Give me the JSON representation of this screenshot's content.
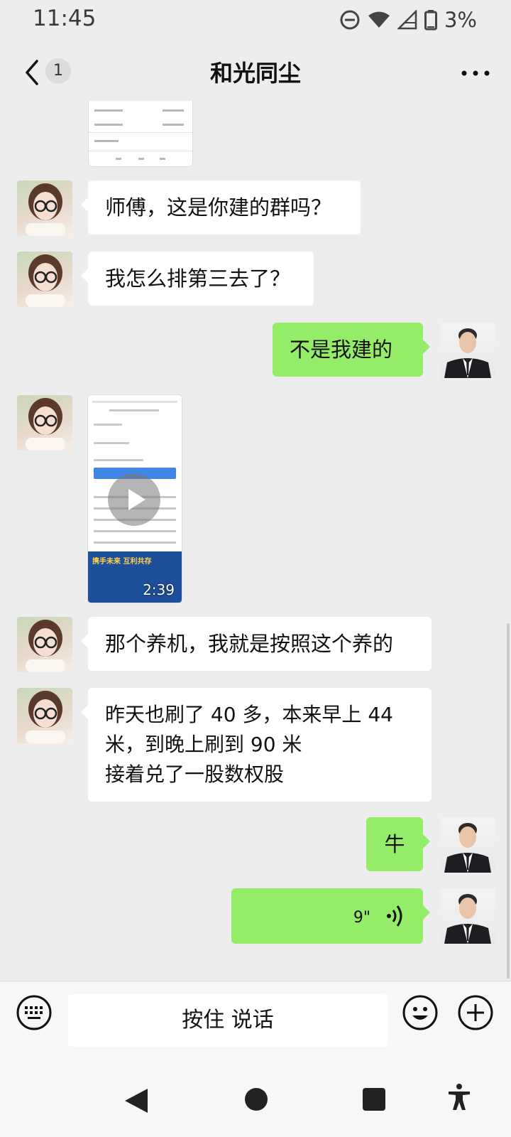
{
  "status_bar": {
    "time": "11:45",
    "battery": "3%"
  },
  "header": {
    "unread_count": "1",
    "title": "和光同尘"
  },
  "messages": [
    {
      "text": "师傅，这是你建的群吗？"
    },
    {
      "text": "我怎么排第三去了？"
    },
    {
      "text": "不是我建的"
    },
    {
      "text": "那个养机，我就是按照这个养的"
    },
    {
      "text": "昨天也刷了 40 多，本来早上 44\n米，到晚上刷到 90 米\n接着兑了一股数权股"
    },
    {
      "text": "牛"
    }
  ],
  "video": {
    "banner": "携手未来 互利共存",
    "duration": "2:39"
  },
  "voice": {
    "duration": "9\""
  },
  "input": {
    "hold_to_talk": "按住 说话"
  },
  "colors": {
    "outgoing_bubble": "#95ec69",
    "incoming_bubble": "#ffffff",
    "background": "#ededed"
  }
}
